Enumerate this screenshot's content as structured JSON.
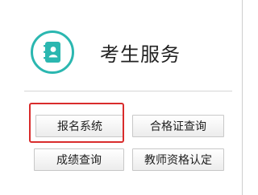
{
  "header": {
    "title": "考生服务",
    "icon": "contact-book-icon",
    "accent_color": "#2bb7b0"
  },
  "buttons": {
    "register": "报名系统",
    "certificate_query": "合格证查询",
    "score_query": "成绩查询",
    "teacher_qualification": "教师资格认定"
  },
  "highlight_color": "#d92c2c"
}
